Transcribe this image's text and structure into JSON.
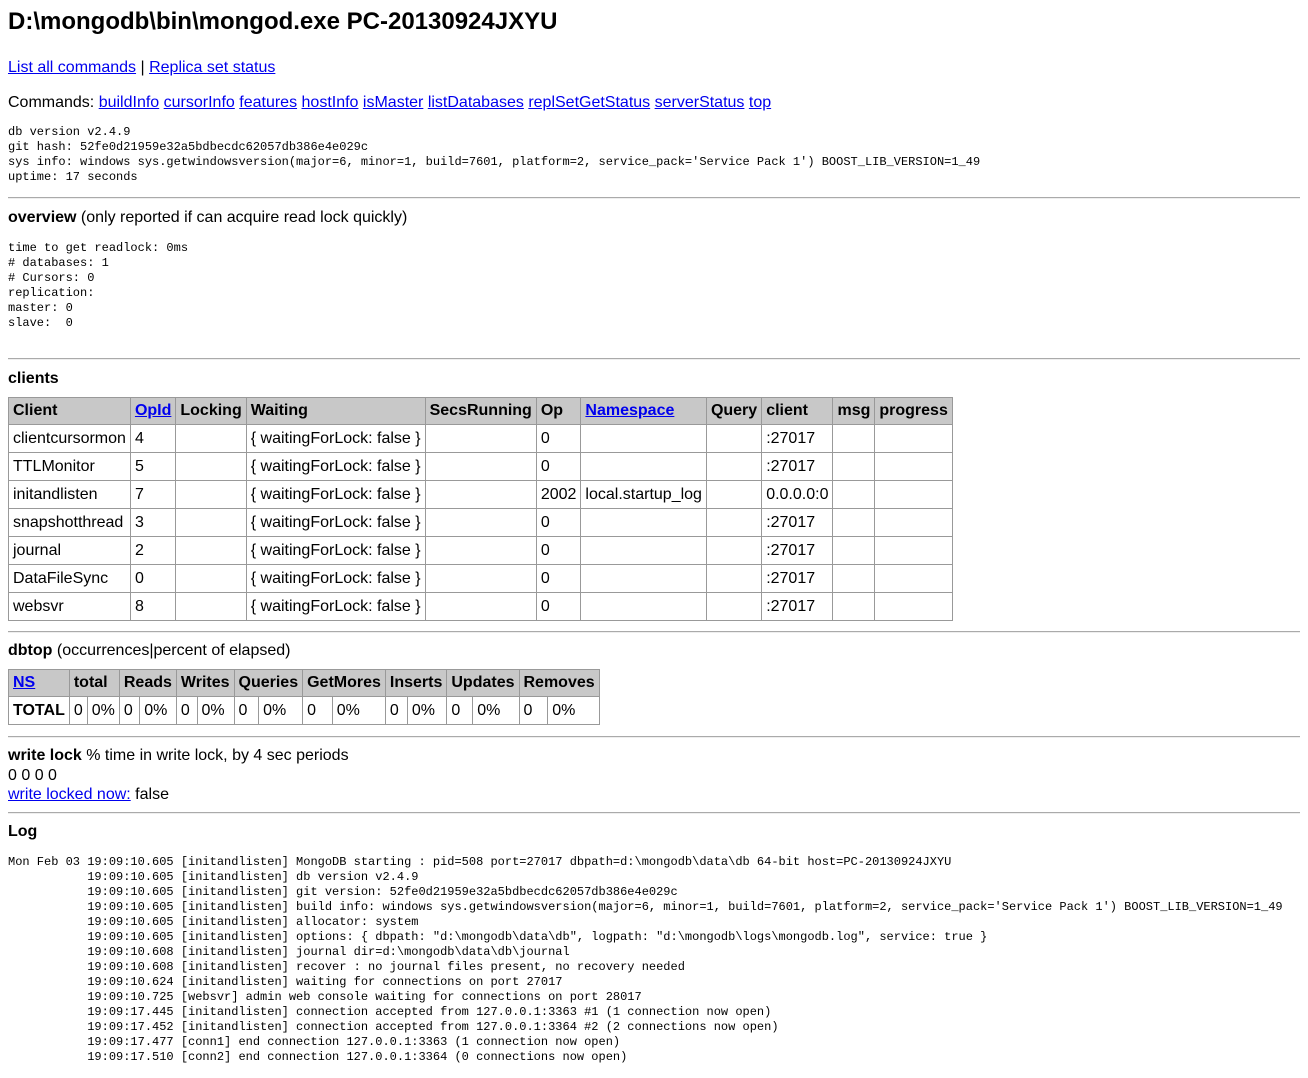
{
  "page": {
    "title": "D:\\mongodb\\bin\\mongod.exe PC-20130924JXYU",
    "top_links": [
      "List all commands",
      "Replica set status"
    ],
    "top_links_sep": " | ",
    "commands_label": "Commands: ",
    "commands": [
      "buildInfo",
      "cursorInfo",
      "features",
      "hostInfo",
      "isMaster",
      "listDatabases",
      "replSetGetStatus",
      "serverStatus",
      "top"
    ]
  },
  "server_info": [
    "db version v2.4.9",
    "git hash: 52fe0d21959e32a5bdbecdc62057db386e4e029c",
    "sys info: windows sys.getwindowsversion(major=6, minor=1, build=7601, platform=2, service_pack='Service Pack 1') BOOST_LIB_VERSION=1_49",
    "uptime: 17 seconds"
  ],
  "overview": {
    "title": "overview",
    "subtitle": " (only reported if can acquire read lock quickly)",
    "lines": [
      "time to get readlock: 0ms",
      "# databases: 1",
      "# Cursors: 0",
      "replication:",
      "master: 0",
      "slave:  0"
    ]
  },
  "clients": {
    "title": "clients",
    "headers": [
      {
        "label": "Client",
        "link": false
      },
      {
        "label": "OpId",
        "link": true
      },
      {
        "label": "Locking",
        "link": false
      },
      {
        "label": "Waiting",
        "link": false
      },
      {
        "label": "SecsRunning",
        "link": false
      },
      {
        "label": "Op",
        "link": false
      },
      {
        "label": "Namespace",
        "link": true
      },
      {
        "label": "Query",
        "link": false
      },
      {
        "label": "client",
        "link": false
      },
      {
        "label": "msg",
        "link": false
      },
      {
        "label": "progress",
        "link": false
      }
    ],
    "rows": [
      [
        "clientcursormon",
        "4",
        "",
        "{ waitingForLock: false }",
        "",
        "0",
        "",
        "",
        ":27017",
        "",
        ""
      ],
      [
        "TTLMonitor",
        "5",
        "",
        "{ waitingForLock: false }",
        "",
        "0",
        "",
        "",
        ":27017",
        "",
        ""
      ],
      [
        "initandlisten",
        "7",
        "",
        "{ waitingForLock: false }",
        "",
        "2002",
        "local.startup_log",
        "",
        "0.0.0.0:0",
        "",
        ""
      ],
      [
        "snapshotthread",
        "3",
        "",
        "{ waitingForLock: false }",
        "",
        "0",
        "",
        "",
        ":27017",
        "",
        ""
      ],
      [
        "journal",
        "2",
        "",
        "{ waitingForLock: false }",
        "",
        "0",
        "",
        "",
        ":27017",
        "",
        ""
      ],
      [
        "DataFileSync",
        "0",
        "",
        "{ waitingForLock: false }",
        "",
        "0",
        "",
        "",
        ":27017",
        "",
        ""
      ],
      [
        "websvr",
        "8",
        "",
        "{ waitingForLock: false }",
        "",
        "0",
        "",
        "",
        ":27017",
        "",
        ""
      ]
    ]
  },
  "dbtop": {
    "title": "dbtop",
    "subtitle": " (occurrences|percent of elapsed)",
    "headers": [
      "NS",
      "total",
      "Reads",
      "Writes",
      "Queries",
      "GetMores",
      "Inserts",
      "Updates",
      "Removes"
    ],
    "row": [
      "TOTAL",
      "0",
      "0%",
      "0",
      "0%",
      "0",
      "0%",
      "0",
      "0%",
      "0",
      "0%",
      "0",
      "0%",
      "0",
      "0%",
      "0",
      "0%"
    ]
  },
  "write_lock": {
    "title": "write lock",
    "subtitle": " % time in write lock, by 4 sec periods",
    "values": "0 0 0 0",
    "link": "write locked now:",
    "status": " false"
  },
  "log": {
    "title": "Log",
    "lines": [
      "Mon Feb 03 19:09:10.605 [initandlisten] MongoDB starting : pid=508 port=27017 dbpath=d:\\mongodb\\data\\db 64-bit host=PC-20130924JXYU",
      "           19:09:10.605 [initandlisten] db version v2.4.9",
      "           19:09:10.605 [initandlisten] git version: 52fe0d21959e32a5bdbecdc62057db386e4e029c",
      "           19:09:10.605 [initandlisten] build info: windows sys.getwindowsversion(major=6, minor=1, build=7601, platform=2, service_pack='Service Pack 1') BOOST_LIB_VERSION=1_49",
      "           19:09:10.605 [initandlisten] allocator: system",
      "           19:09:10.605 [initandlisten] options: { dbpath: \"d:\\mongodb\\data\\db\", logpath: \"d:\\mongodb\\logs\\mongodb.log\", service: true }",
      "           19:09:10.608 [initandlisten] journal dir=d:\\mongodb\\data\\db\\journal",
      "           19:09:10.608 [initandlisten] recover : no journal files present, no recovery needed",
      "           19:09:10.624 [initandlisten] waiting for connections on port 27017",
      "           19:09:10.725 [websvr] admin web console waiting for connections on port 28017",
      "           19:09:17.445 [initandlisten] connection accepted from 127.0.0.1:3363 #1 (1 connection now open)",
      "           19:09:17.452 [initandlisten] connection accepted from 127.0.0.1:3364 #2 (2 connections now open)",
      "           19:09:17.477 [conn1] end connection 127.0.0.1:3363 (1 connection now open)",
      "           19:09:17.510 [conn2] end connection 127.0.0.1:3364 (0 connections now open)"
    ]
  }
}
